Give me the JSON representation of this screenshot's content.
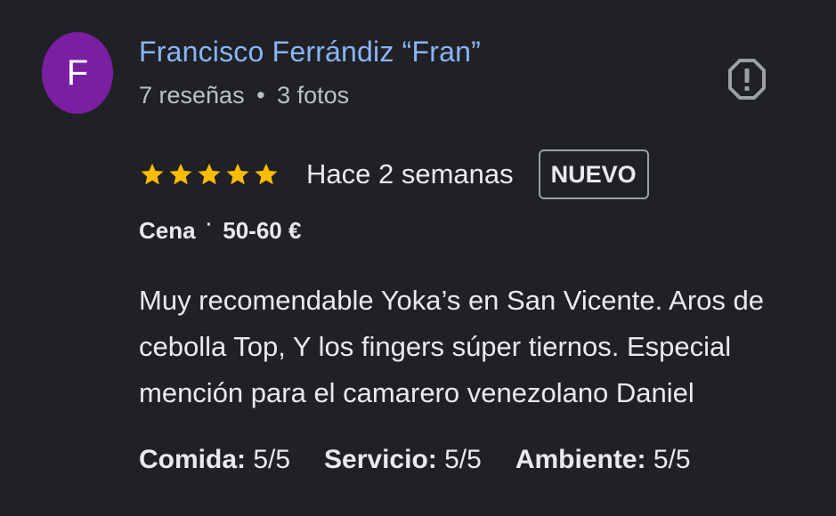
{
  "reviewer": {
    "avatar_letter": "F",
    "avatar_color": "#7b1fa2",
    "name": "Francisco Ferrándiz “Fran”",
    "reviews": "7 reseñas",
    "separator": "•",
    "photos": "3 fotos"
  },
  "report_icon": "report-flag-icon",
  "rating": {
    "stars": 5,
    "max": 5,
    "star_color": "#fbbc04",
    "date": "Hace 2 semanas",
    "badge": "NUEVO"
  },
  "meal": {
    "type": "Cena",
    "separator": "·",
    "price": "50-60 €"
  },
  "review_text": "Muy recomendable Yoka’s en San Vicente. Aros de cebolla Top, Y los fingers súper tiernos. Especial mención para el camarero venezolano Daniel",
  "scores": [
    {
      "label": "Comida:",
      "value": "5/5"
    },
    {
      "label": "Servicio:",
      "value": "5/5"
    },
    {
      "label": "Ambiente:",
      "value": "5/5"
    }
  ]
}
